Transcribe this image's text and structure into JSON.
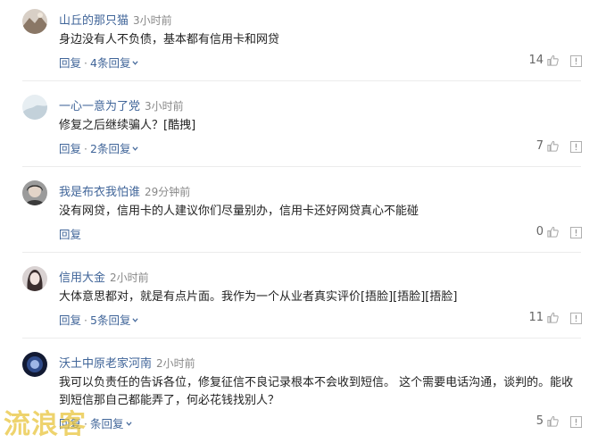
{
  "comments": [
    {
      "user": "山丘的那只猫",
      "time": "3小时前",
      "text": "身边没有人不负债，基本都有信用卡和网贷",
      "reply_label": "回复",
      "replies_label": "4条回复",
      "likes": "14",
      "avatar_color": "#9a8676"
    },
    {
      "user": "一心一意为了党",
      "time": "3小时前",
      "text": "修复之后继续骗人？[酷拽]",
      "reply_label": "回复",
      "replies_label": "2条回复",
      "likes": "7",
      "avatar_color": "#c9d6df"
    },
    {
      "user": "我是布衣我怕谁",
      "time": "29分钟前",
      "text": "没有网贷，信用卡的人建议你们尽量别办，信用卡还好网贷真心不能碰",
      "reply_label": "回复",
      "replies_label": "",
      "likes": "0",
      "avatar_color": "#6b6b6b"
    },
    {
      "user": "信用大金",
      "time": "2小时前",
      "text": "大体意思都对，就是有点片面。我作为一个从业者真实评价[捂脸][捂脸][捂脸]",
      "reply_label": "回复",
      "replies_label": "5条回复",
      "likes": "11",
      "avatar_color": "#b9a9a9"
    },
    {
      "user": "沃土中原老家河南",
      "time": "2小时前",
      "text": "我可以负责任的告诉各位，修复征信不良记录根本不会收到短信。 这个需要电话沟通，谈判的。能收到短信那自己都能弄了，何必花钱找别人？",
      "reply_label": "回复",
      "replies_label": "条回复",
      "likes": "5",
      "avatar_color": "#1e2a4a"
    }
  ],
  "watermark": "流浪客",
  "colors": {
    "link": "#406599",
    "muted": "#888888",
    "divider": "#ececec"
  }
}
